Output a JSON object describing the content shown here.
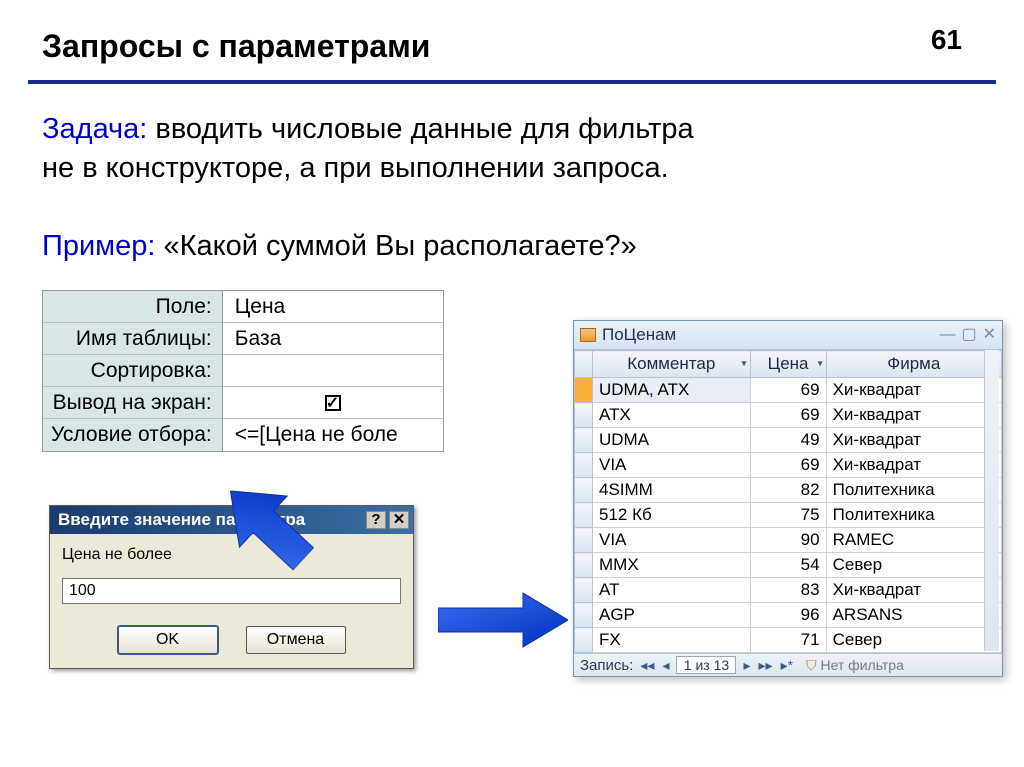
{
  "page_number": "61",
  "heading": "Запросы с параметрами",
  "task_label": "Задача:",
  "task_text_1": " вводить числовые данные для фильтра",
  "task_text_2": "не в конструкторе, а при выполнении запроса.",
  "example_label": "Пример:",
  "example_text": " «Какой суммой Вы располагаете?»",
  "design": {
    "labels": {
      "field": "Поле:",
      "table": "Имя таблицы:",
      "sort": "Сортировка:",
      "show": "Вывод на экран:",
      "criteria": "Условие отбора:"
    },
    "values": {
      "field": "Цена",
      "table": "База",
      "sort": "",
      "criteria": "<=[Цена не боле"
    }
  },
  "dialog": {
    "title": "Введите значение параметра",
    "help_btn": "?",
    "close_btn": "✕",
    "prompt": "Цена не более",
    "input_value": "100",
    "ok_label": "OK",
    "cancel_label": "Отмена"
  },
  "datasheet": {
    "title": "ПоЦенам",
    "columns": [
      "Комментар",
      "Цена",
      "Фирма"
    ],
    "rows": [
      {
        "c": "UDMA, ATX",
        "p": "69",
        "f": "Хи-квадрат"
      },
      {
        "c": "ATX",
        "p": "69",
        "f": "Хи-квадрат"
      },
      {
        "c": "UDMA",
        "p": "49",
        "f": "Хи-квадрат"
      },
      {
        "c": "VIA",
        "p": "69",
        "f": "Хи-квадрат"
      },
      {
        "c": "4SIMM",
        "p": "82",
        "f": "Политехника"
      },
      {
        "c": "512 Кб",
        "p": "75",
        "f": "Политехника"
      },
      {
        "c": "VIA",
        "p": "90",
        "f": "RAMEC"
      },
      {
        "c": "MMX",
        "p": "54",
        "f": "Север"
      },
      {
        "c": "AT",
        "p": "83",
        "f": "Хи-квадрат"
      },
      {
        "c": "AGP",
        "p": "96",
        "f": "ARSANS"
      },
      {
        "c": "FX",
        "p": "71",
        "f": "Север"
      }
    ],
    "nav_label": "Запись:",
    "nav_position": "1 из 13",
    "no_filter": "Нет фильтра"
  }
}
